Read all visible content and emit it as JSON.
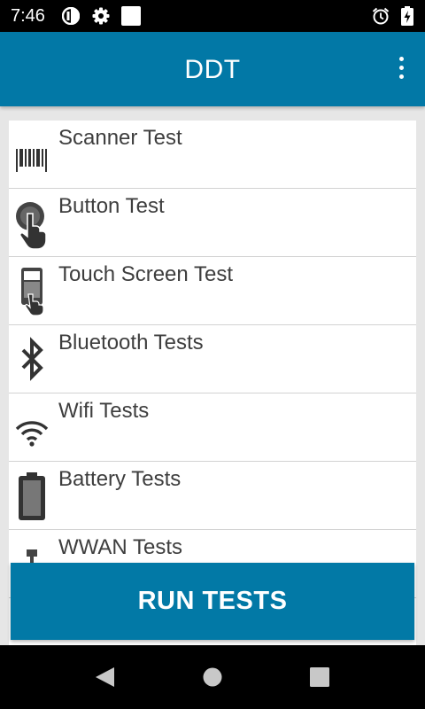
{
  "status_bar": {
    "time": "7:46",
    "left_icons": [
      "data-saver-icon",
      "settings-gear-icon",
      "blank-notification-icon"
    ],
    "right_icons": [
      "alarm-clock-icon",
      "battery-charging-icon"
    ]
  },
  "app_bar": {
    "title": "DDT",
    "menu_icon": "overflow-menu-icon",
    "color": "#0278a6"
  },
  "tests": [
    {
      "label": "Scanner Test",
      "icon": "barcode-icon"
    },
    {
      "label": "Button Test",
      "icon": "button-press-icon"
    },
    {
      "label": "Touch Screen Test",
      "icon": "touch-screen-icon"
    },
    {
      "label": "Bluetooth Tests",
      "icon": "bluetooth-icon"
    },
    {
      "label": "Wifi Tests",
      "icon": "wifi-icon"
    },
    {
      "label": "Battery Tests",
      "icon": "battery-icon"
    },
    {
      "label": "WWAN Tests",
      "icon": "network-icon"
    }
  ],
  "run_button": {
    "label": "RUN TESTS",
    "color": "#0279a6"
  },
  "nav_bar": {
    "buttons": [
      "back-icon",
      "home-icon",
      "recents-icon"
    ]
  }
}
